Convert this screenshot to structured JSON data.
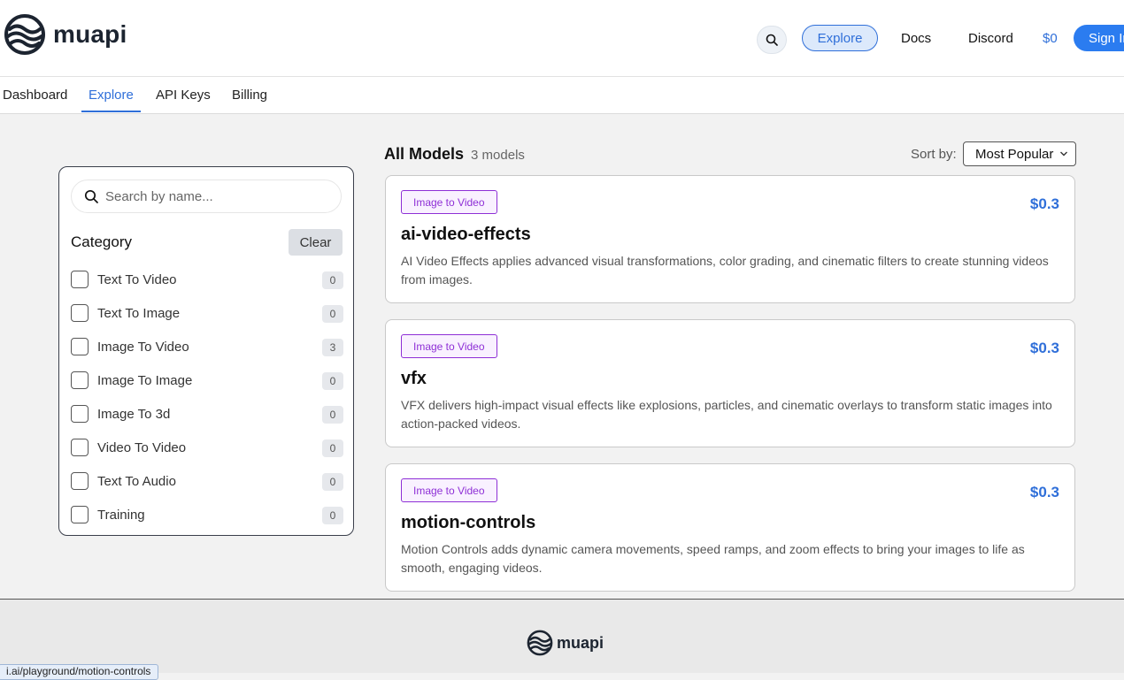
{
  "brand": {
    "name": "muapi"
  },
  "header": {
    "explore_label": "Explore",
    "docs_label": "Docs",
    "discord_label": "Discord",
    "balance": "$0",
    "signin_label": "Sign In"
  },
  "tabs": [
    {
      "label": "Dashboard"
    },
    {
      "label": "Explore",
      "active": true
    },
    {
      "label": "API Keys"
    },
    {
      "label": "Billing"
    }
  ],
  "filters": {
    "search_placeholder": "Search by name...",
    "category_title": "Category",
    "clear_label": "Clear",
    "categories": [
      {
        "label": "Text To Video",
        "count": "0"
      },
      {
        "label": "Text To Image",
        "count": "0"
      },
      {
        "label": "Image To Video",
        "count": "3"
      },
      {
        "label": "Image To Image",
        "count": "0"
      },
      {
        "label": "Image To 3d",
        "count": "0"
      },
      {
        "label": "Video To Video",
        "count": "0"
      },
      {
        "label": "Text To Audio",
        "count": "0"
      },
      {
        "label": "Training",
        "count": "0"
      }
    ]
  },
  "models": {
    "title": "All Models",
    "count_label": "3 models",
    "sort_label": "Sort by:",
    "sort_value": "Most Popular",
    "items": [
      {
        "tag": "Image to Video",
        "price": "$0.3",
        "name": "ai-video-effects",
        "description": "AI Video Effects applies advanced visual transformations, color grading, and cinematic filters to create stunning videos from images."
      },
      {
        "tag": "Image to Video",
        "price": "$0.3",
        "name": "vfx",
        "description": "VFX delivers high-impact visual effects like explosions, particles, and cinematic overlays to transform static images into action-packed videos."
      },
      {
        "tag": "Image to Video",
        "price": "$0.3",
        "name": "motion-controls",
        "description": "Motion Controls adds dynamic camera movements, speed ramps, and zoom effects to bring your images to life as smooth, engaging videos."
      }
    ]
  },
  "footer": {
    "brand": "muapi"
  },
  "status_bar": {
    "url": "i.ai/playground/motion-controls"
  },
  "colors": {
    "accent": "#2f6fd9",
    "tag": "#8e2fd6",
    "background": "#f2f2f2"
  }
}
